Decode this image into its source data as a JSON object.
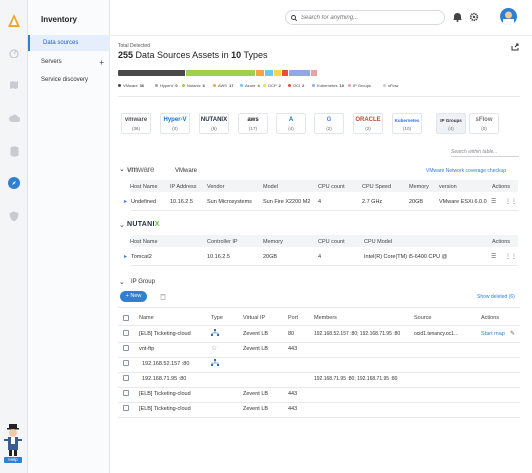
{
  "app": {
    "title": "Inventory",
    "search_placeholder": "Search for anything...",
    "help_label": "Help"
  },
  "subnav": {
    "items": [
      {
        "label": "Data sources",
        "active": true
      },
      {
        "label": "Servers",
        "active": false
      },
      {
        "label": "Service discovery",
        "active": false
      }
    ],
    "add_symbol": "+"
  },
  "summary": {
    "label": "Total Detected",
    "count": "255",
    "text1": "Data Sources Assets in",
    "types": "10",
    "text2": "Types"
  },
  "distribution": {
    "segments": [
      {
        "name": "VMware",
        "count": "36",
        "color": "#4a4a4a",
        "fraction": 0.35
      },
      {
        "name": "HyperV",
        "count": "0",
        "color": "#a5a7aa",
        "fraction": 0
      },
      {
        "name": "Nutanix",
        "count": "6",
        "color": "#9fd04a",
        "fraction": 0.36
      },
      {
        "name": "AWS",
        "count": "17",
        "color": "#f2a541",
        "fraction": 0.04
      },
      {
        "name": "Azure",
        "count": "4",
        "color": "#6ec6e8",
        "fraction": 0.04
      },
      {
        "name": "GCP",
        "count": "2",
        "color": "#f4d84a",
        "fraction": 0.04
      },
      {
        "name": "OCI",
        "count": "2",
        "color": "#e74c3c",
        "fraction": 0.03
      },
      {
        "name": "Kubernetes",
        "count": "10",
        "color": "#8ea9e3",
        "fraction": 0.11
      },
      {
        "name": "IP Groups",
        "count": "",
        "color": "#e9a0a8",
        "fraction": 0.03
      },
      {
        "name": "sFlow",
        "count": "",
        "color": "#cccccc",
        "fraction": 0
      }
    ]
  },
  "tiles": [
    {
      "logo": "vmware",
      "count": "(36)",
      "color": "#555"
    },
    {
      "logo": "Hyper-V",
      "count": "(0)",
      "color": "#0a6fd8"
    },
    {
      "logo": "NUTANIX",
      "count": "(6)",
      "color": "#1f2d3d"
    },
    {
      "logo": "aws",
      "count": "(17)",
      "color": "#222"
    },
    {
      "logo": "A",
      "count": "(4)",
      "color": "#0078d4"
    },
    {
      "logo": "G",
      "count": "(2)",
      "color": "#4285f4"
    },
    {
      "logo": "ORACLE",
      "count": "(2)",
      "color": "#c74634"
    },
    {
      "logo": "Kubernetes",
      "count": "(10)",
      "color": "#326ce5"
    },
    {
      "logo": "IP Groups",
      "count": "(4)",
      "color": "#333"
    },
    {
      "logo": "sFlow",
      "count": "(0)",
      "color": "#777"
    }
  ],
  "table_filter_placeholder": "Search within table...",
  "vmware": {
    "name": "VMware",
    "link": "VMware Network coverage checkup",
    "headers": [
      "Host Name",
      "IP Address",
      "Vendor",
      "Model",
      "CPU count",
      "CPU Speed",
      "Memory",
      "version",
      "Actions"
    ],
    "row": [
      "Undefined",
      "10.16.2.5",
      "Sun Microsystems",
      "Sun Fire X2200 M2",
      "4",
      "2.7 GHz",
      "20GB",
      "VMware ESXi 6.0.0"
    ]
  },
  "nutanix": {
    "headers": [
      "Host Name",
      "Controller IP",
      "Memory",
      "CPU count",
      "CPU Model",
      "Actions"
    ],
    "row": [
      "Tomcat2",
      "10.16.2.5",
      "20GB",
      "4",
      "Intel(R) Core(TM) i5-6400 CPU @"
    ]
  },
  "ipgroup": {
    "title": "IP Group",
    "new_label": "+ New",
    "show_deleted": "Show deleted (6)",
    "headers": [
      "Name",
      "Type",
      "Virtual IP",
      "Port",
      "Members",
      "Source",
      "Actions"
    ],
    "rows": [
      {
        "name": "[ELB] Ticketing-cloud",
        "vip": "Zevent LB",
        "port": "80",
        "members": "192.168.52.157 :80; 192.168.71.95 :80",
        "source": "ocid1.tenancy.oc1...",
        "action": "Start map",
        "icon": "network"
      },
      {
        "name": "vnt-ftp",
        "vip": "Zevent LB",
        "port": "443",
        "members": "",
        "source": "",
        "action": "",
        "icon": "star"
      },
      {
        "name": "192.168.52.157 :80",
        "vip": "",
        "port": "",
        "members": "",
        "source": "",
        "action": "",
        "icon": "network"
      },
      {
        "name": "192.168.71.95 :80",
        "vip": "",
        "port": "",
        "members": "192.168.71.95 :80; 192.168.71.95 :80",
        "source": "",
        "action": "",
        "icon": ""
      },
      {
        "name": "[ELB] Ticketing-cloud",
        "vip": "Zevent LB",
        "port": "443",
        "members": "",
        "source": "",
        "action": "",
        "icon": ""
      },
      {
        "name": "[ELB] Ticketing-cloud",
        "vip": "Zevent LB",
        "port": "443",
        "members": "",
        "source": "",
        "action": "",
        "icon": ""
      }
    ]
  }
}
